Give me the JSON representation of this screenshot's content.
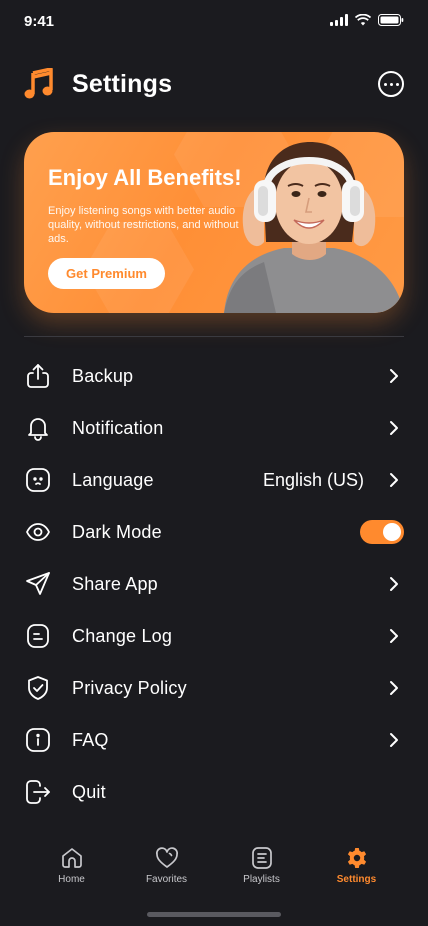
{
  "status": {
    "time": "9:41"
  },
  "header": {
    "title": "Settings"
  },
  "promo": {
    "title": "Enjoy All Benefits!",
    "text": "Enjoy listening songs with better audio quality, without restrictions, and without ads.",
    "button_label": "Get Premium"
  },
  "menu": {
    "items": [
      {
        "label": "Backup",
        "icon": "upload-icon"
      },
      {
        "label": "Notification",
        "icon": "bell-icon"
      },
      {
        "label": "Language",
        "value": "English (US)",
        "icon": "language-icon"
      },
      {
        "label": "Dark Mode",
        "icon": "eye-icon",
        "toggle_on": true
      },
      {
        "label": "Share App",
        "icon": "send-icon"
      },
      {
        "label": "Change Log",
        "icon": "document-icon"
      },
      {
        "label": "Privacy Policy",
        "icon": "shield-icon"
      },
      {
        "label": "FAQ",
        "icon": "info-icon"
      },
      {
        "label": "Quit",
        "icon": "logout-icon"
      }
    ]
  },
  "tabs": [
    {
      "label": "Home",
      "icon": "home-icon"
    },
    {
      "label": "Favorites",
      "icon": "heart-icon"
    },
    {
      "label": "Playlists",
      "icon": "playlist-icon"
    },
    {
      "label": "Settings",
      "icon": "gear-icon",
      "active": true
    }
  ],
  "colors": {
    "accent": "#ff8a2e",
    "background": "#1b1b1f"
  }
}
